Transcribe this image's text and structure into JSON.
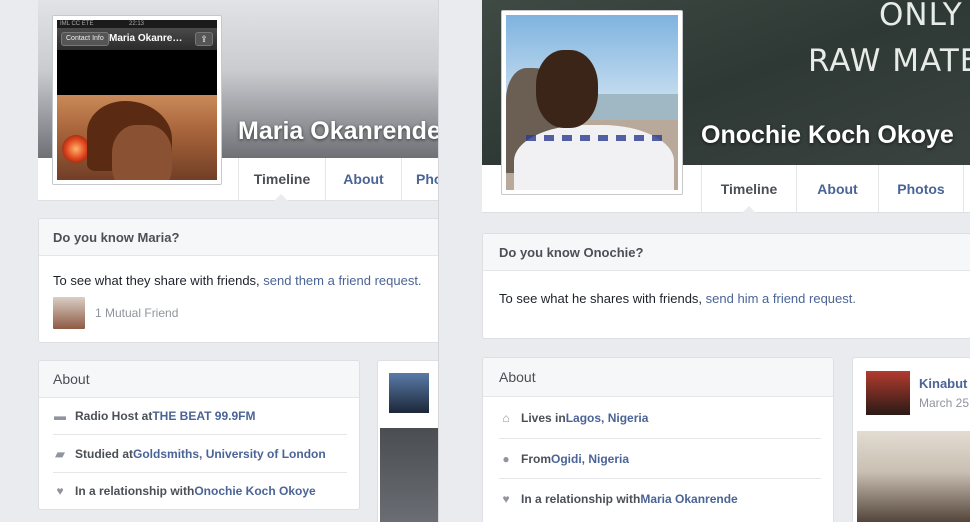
{
  "left": {
    "cover_name": "Maria Okanrende",
    "phone": {
      "status_text": "IML CC ETE",
      "time": "22:13",
      "contact_button": "Contact Info",
      "title": "Maria Okanre…",
      "share_glyph": "⇪"
    },
    "tabs": [
      "Timeline",
      "About",
      "Pho"
    ],
    "know_card": {
      "title": "Do you know Maria?",
      "text_prefix": "To see what they share with friends, ",
      "link": "send them a friend request.",
      "mutual": "1 Mutual Friend"
    },
    "about_card": {
      "title": "About",
      "rows": [
        {
          "icon": "briefcase-icon",
          "prefix": "Radio Host at ",
          "link": "THE BEAT 99.9FM"
        },
        {
          "icon": "graduation-cap-icon",
          "prefix": "Studied at ",
          "link": "Goldsmiths, University of London"
        },
        {
          "icon": "heart-icon",
          "prefix": "In a relationship with ",
          "link": "Onochie Koch Okoye"
        }
      ]
    }
  },
  "right": {
    "cover_name": "Onochie Koch Okoye",
    "cover_text_1": "ONLY",
    "cover_text_2": "RAW MATE",
    "tabs": [
      "Timeline",
      "About",
      "Photos"
    ],
    "know_card": {
      "title": "Do you know Onochie?",
      "text_prefix": "To see what he shares with friends, ",
      "link": "send him a friend request."
    },
    "about_card": {
      "title": "About",
      "rows": [
        {
          "icon": "home-icon",
          "prefix": "Lives in ",
          "link": "Lagos, Nigeria"
        },
        {
          "icon": "location-pin-icon",
          "prefix": "From ",
          "link": "Ogidi, Nigeria"
        },
        {
          "icon": "heart-icon",
          "prefix": "In a relationship with ",
          "link": "Maria Okanrende"
        }
      ]
    },
    "feed": {
      "name": "Kinabut",
      "date": "March 25"
    }
  },
  "colors": {
    "link": "#4b6496",
    "background": "#e9ebee",
    "card_header": "#f6f7f9"
  }
}
